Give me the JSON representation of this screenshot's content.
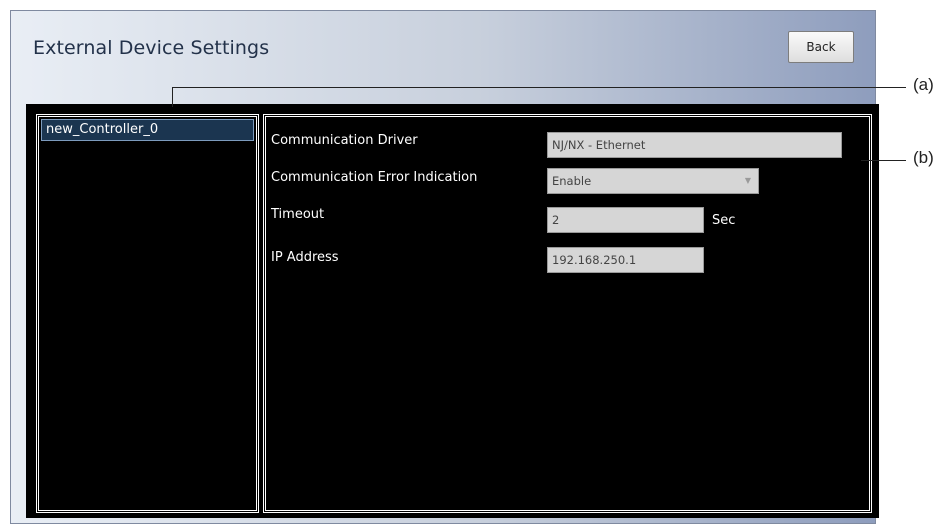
{
  "window": {
    "title": "External Device Settings",
    "back_label": "Back"
  },
  "devices": {
    "items": [
      "new_Controller_0"
    ],
    "selected": "new_Controller_0"
  },
  "settings": {
    "driver_label": "Communication Driver",
    "driver_value": "NJ/NX - Ethernet",
    "error_label": "Communication Error Indication",
    "error_value": "Enable",
    "timeout_label": "Timeout",
    "timeout_value": "2",
    "timeout_unit": "Sec",
    "ip_label": "IP Address",
    "ip_value": "192.168.250.1"
  },
  "callouts": {
    "a": "(a)",
    "b": "(b)"
  }
}
